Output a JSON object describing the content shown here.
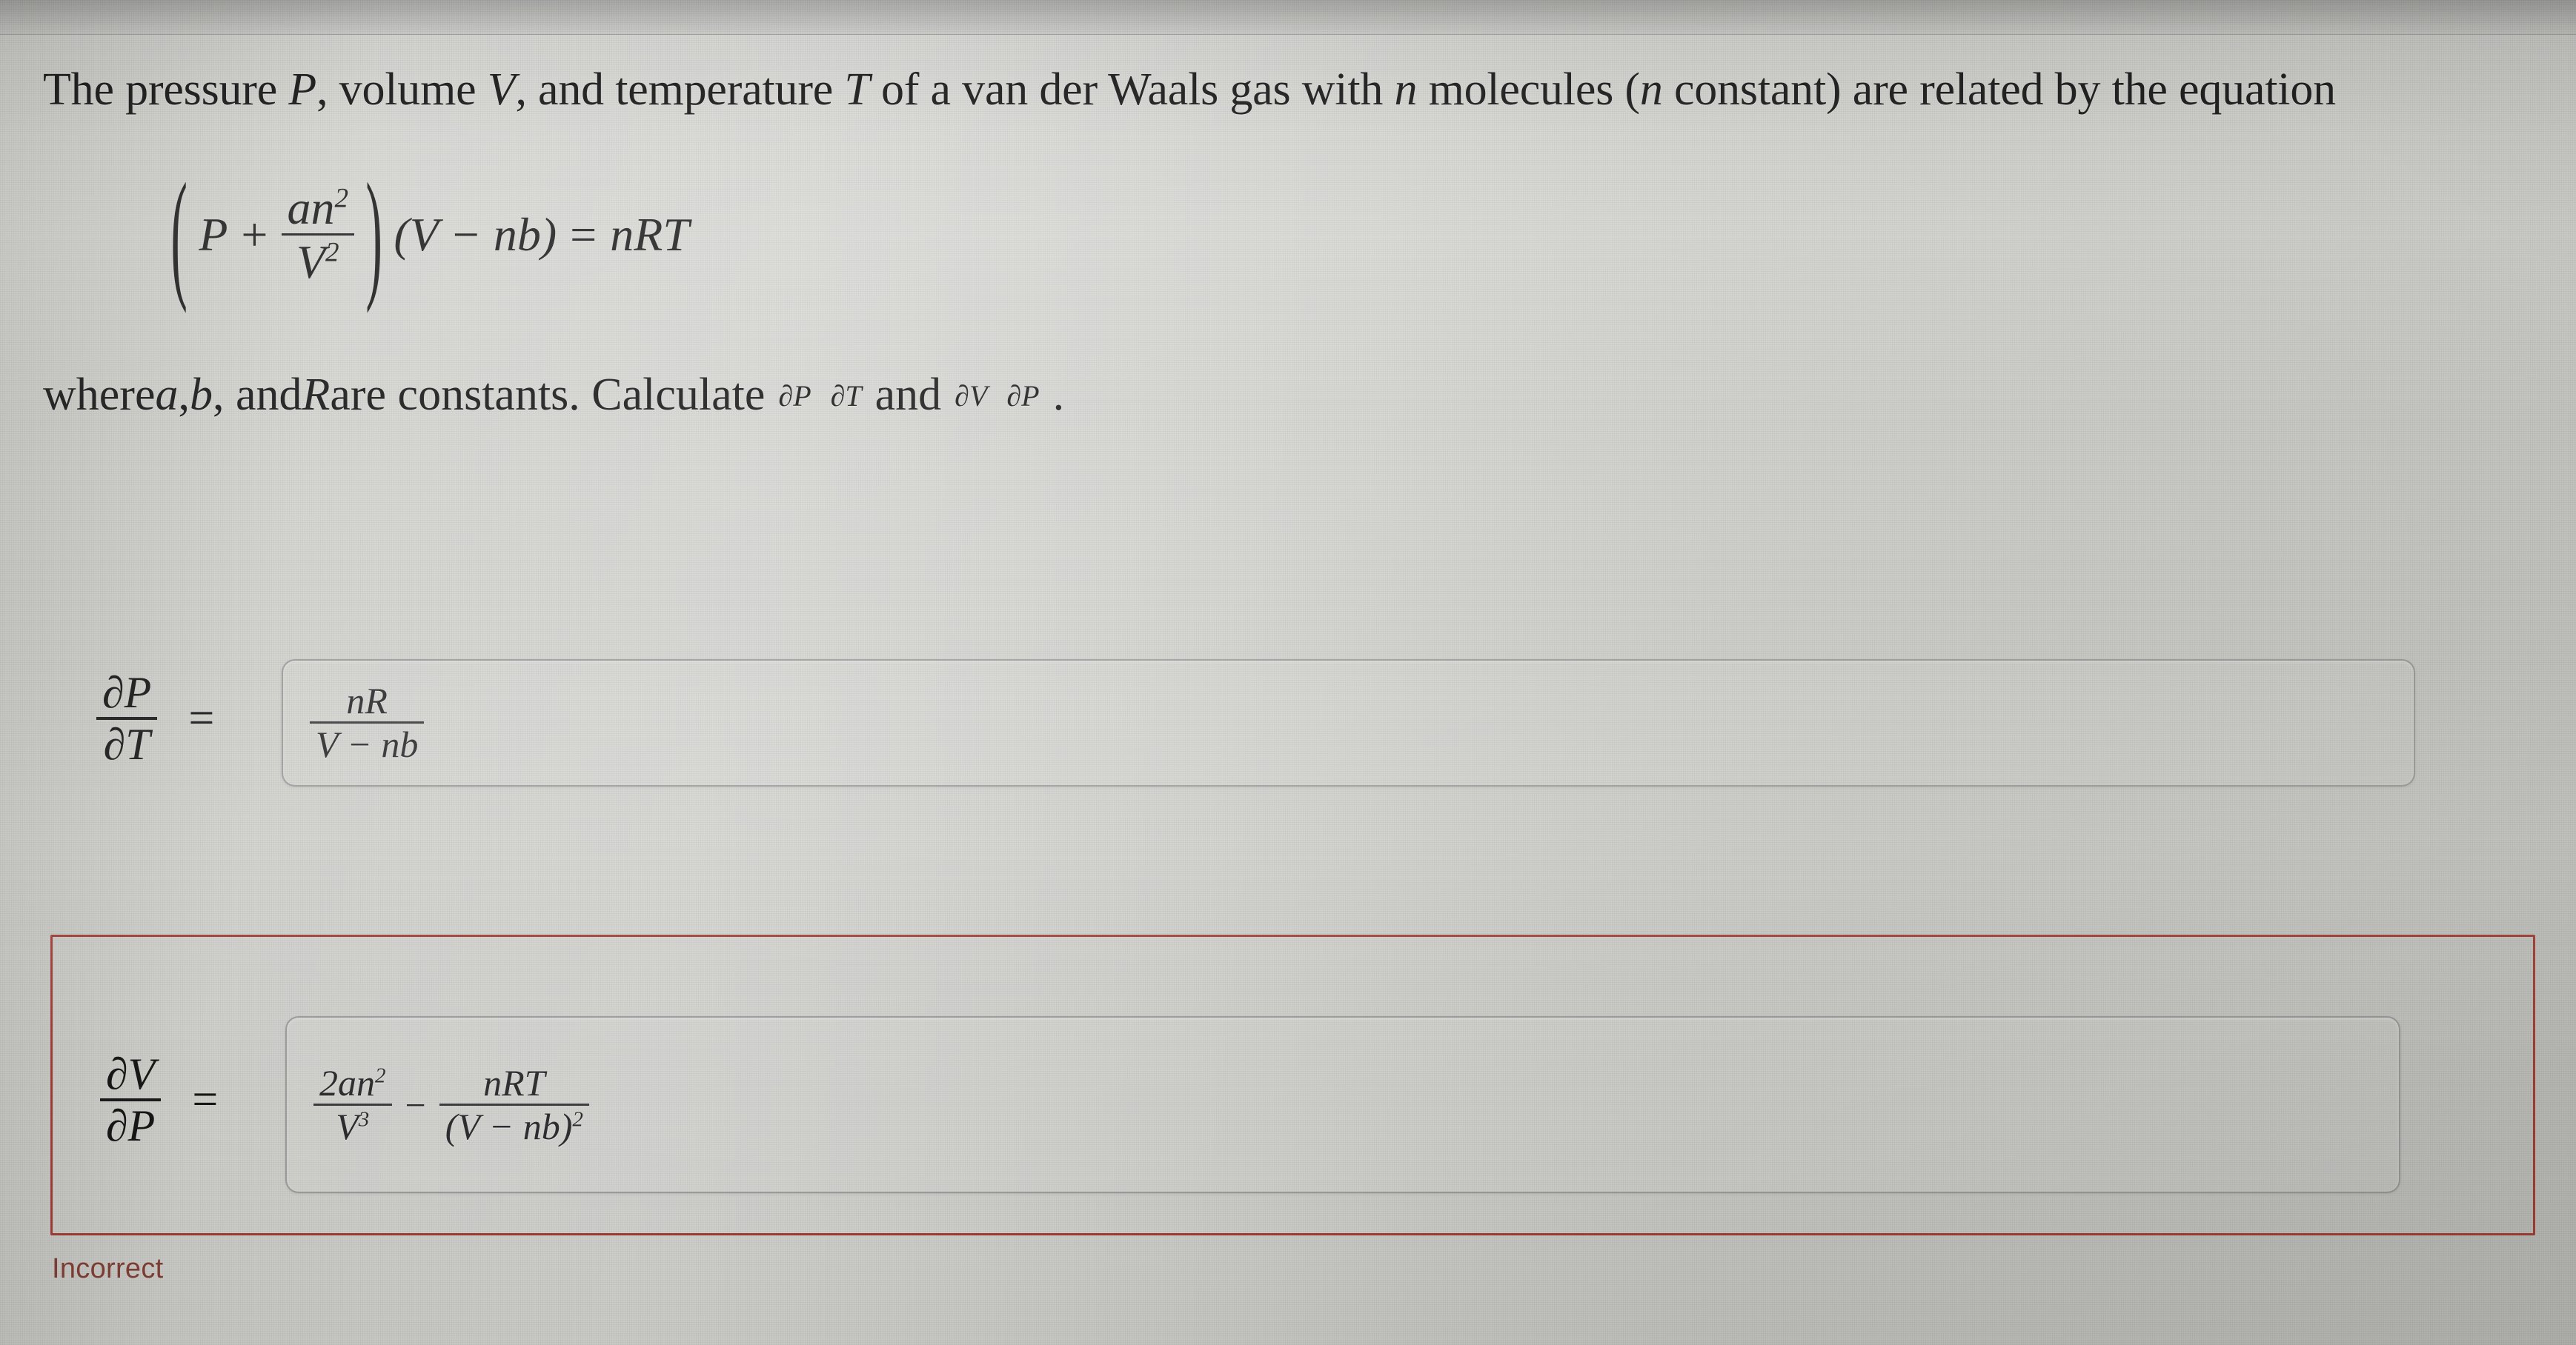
{
  "problem": {
    "statement_line": "The pressure P, volume V, and temperature T of a van der Waals gas with n molecules (n constant) are related by the equation",
    "statement_parts": {
      "p1": "The pressure ",
      "v_P": "P",
      "p2": ", volume ",
      "v_V": "V",
      "p3": ", and temperature ",
      "v_T": "T",
      "p4": " of a van der Waals gas with ",
      "v_n": "n",
      "p5": " molecules (",
      "v_n2": "n",
      "p6": " constant) are related by the equation"
    },
    "equation": {
      "lparen": "(",
      "P": "P",
      "plus": "+",
      "frac_num_a": "an",
      "frac_num_exp": "2",
      "frac_den_V": "V",
      "frac_den_exp": "2",
      "rparen": ")",
      "group": "(V − nb)",
      "equals": "=",
      "rhs": "nRT"
    },
    "where_parts": {
      "w1": "where ",
      "a": "a",
      "w2": ", ",
      "b": "b",
      "w3": ", and ",
      "R": "R",
      "w4": " are constants. Calculate ",
      "d1_num": "∂P",
      "d1_den": "∂T",
      "w5": " and ",
      "d2_num": "∂V",
      "d2_den": "∂P",
      "w6": "."
    }
  },
  "answers": [
    {
      "lhs_num": "∂P",
      "lhs_den": "∂T",
      "equals": "=",
      "value_num": "nR",
      "value_den": "V − nb",
      "status": ""
    },
    {
      "lhs_num": "∂V",
      "lhs_den": "∂P",
      "equals": "=",
      "term1_num": "2an",
      "term1_num_exp": "2",
      "term1_den": "V",
      "term1_den_exp": "3",
      "operator": "−",
      "term2_num": "nRT",
      "term2_den": "(V − nb)",
      "term2_den_exp": "2",
      "status": "Incorrect"
    }
  ],
  "colors": {
    "incorrect_border": "#9d3b33",
    "incorrect_text": "#7e3d33",
    "input_border": "#797b7c",
    "text": "#161616",
    "screen_bg": "#c9c9c6"
  }
}
